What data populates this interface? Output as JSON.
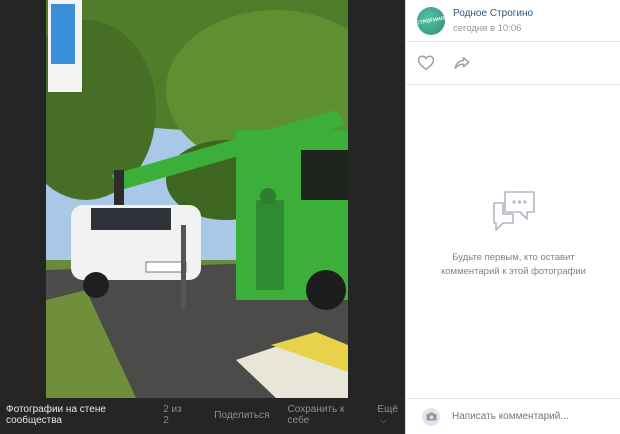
{
  "viewer": {
    "album_title": "Фотографии на стене сообщества",
    "counter": "2 из 2",
    "share_label": "Поделиться",
    "save_label": "Сохранить к себе",
    "more_label": "Ещё"
  },
  "post": {
    "group_name": "Родное Строгино",
    "time": "сегодня в 10:06",
    "avatar_text": "СТРОГИНО"
  },
  "comments": {
    "empty_text": "Будьте первым, кто оставит комментарий к этой фотографии",
    "placeholder": "Написать комментарий..."
  },
  "icons": [
    "heart-icon",
    "share-icon",
    "comment-bubble-icon",
    "camera-icon",
    "chevron-down-icon"
  ],
  "colors": {
    "link": "#2a5885",
    "viewer_bg": "#252525",
    "accent": "#55c2a6"
  }
}
